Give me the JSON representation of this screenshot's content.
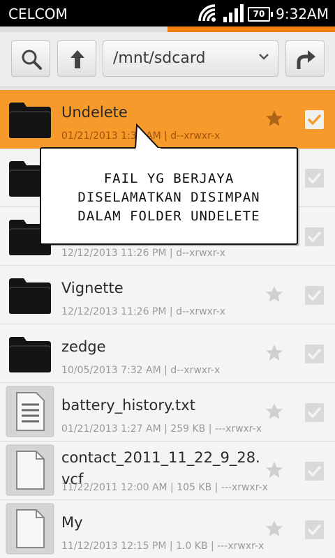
{
  "status_bar": {
    "carrier": "CELCOM",
    "battery": "70",
    "time": "9:32AM",
    "icons": [
      "wifi-icon",
      "signal-icon",
      "battery-icon"
    ]
  },
  "progress": {
    "value_percent": 50,
    "color": "#f47d12"
  },
  "toolbar": {
    "path": "/mnt/sdcard",
    "icons": [
      "search-icon",
      "up-arrow-icon",
      "dropdown-chevron-icon",
      "back-arrow-icon"
    ]
  },
  "colors": {
    "accent": "#f79a2c",
    "bubble_border": "#111111"
  },
  "files": [
    {
      "name": "Undelete",
      "meta": "01/21/2013 1:30 AM  |  d--xrwxr-x",
      "type": "folder",
      "selected": true,
      "checked": true,
      "starred": true
    },
    {
      "name": "",
      "meta": "",
      "type": "folder",
      "selected": false,
      "checked": true,
      "starred": false
    },
    {
      "name": "",
      "meta": "12/12/2013 11:26 PM  |  d--xrwxr-x",
      "type": "folder",
      "selected": false,
      "checked": true,
      "starred": false
    },
    {
      "name": "Vignette",
      "meta": "12/12/2013 11:26 PM  |  d--xrwxr-x",
      "type": "folder",
      "selected": false,
      "checked": true,
      "starred": false
    },
    {
      "name": "zedge",
      "meta": "10/05/2013 7:32 AM  |  d--xrwxr-x",
      "type": "folder",
      "selected": false,
      "checked": true,
      "starred": false
    },
    {
      "name": "battery_history.txt",
      "meta": "01/21/2013 1:27 AM  |  259 KB  |  ---xrwxr-x",
      "type": "text",
      "selected": false,
      "checked": true,
      "starred": false
    },
    {
      "name": "contact_2011_11_22_9_28.vcf",
      "meta": "11/22/2011 12:00 AM  |  105 KB  |  ---xrwxr-x",
      "type": "file",
      "selected": false,
      "checked": true,
      "starred": false
    },
    {
      "name": "My",
      "meta": "11/12/2013 12:15 PM  |  1.0 KB  |  ---xrwxr-x",
      "type": "file",
      "selected": false,
      "checked": true,
      "starred": false
    }
  ],
  "callout": {
    "lines": [
      "FAIL YG BERJAYA",
      "DISELAMATKAN DISIMPAN",
      "DALAM FOLDER UNDELETE"
    ]
  }
}
